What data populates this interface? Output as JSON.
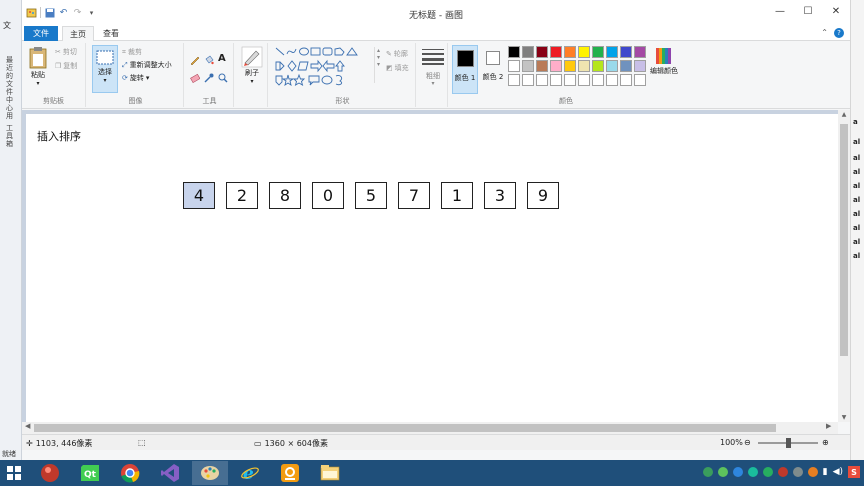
{
  "left_app": {
    "label_top": "文",
    "vertical_text_1": "最近的文件中心用",
    "vertical_text_2": "工具箱",
    "status": "就绪"
  },
  "right_app": {
    "letters": [
      "a",
      "al",
      "al",
      "al",
      "al",
      "al",
      "al",
      "al",
      "al",
      "al",
      "nt"
    ]
  },
  "window": {
    "title": "无标题 - 画图",
    "controls": {
      "minimize": "—",
      "maximize": "☐",
      "close": "✕"
    }
  },
  "tabs": {
    "file": "文件",
    "home": "主页",
    "view": "查看",
    "collapse": "⌃"
  },
  "ribbon": {
    "clipboard": {
      "label": "剪贴板",
      "paste": "粘贴",
      "cut": "剪切",
      "copy": "复制"
    },
    "image": {
      "label": "图像",
      "select": "选择",
      "crop": "裁剪",
      "resize": "重新调整大小",
      "rotate": "旋转"
    },
    "tools": {
      "label": "工具"
    },
    "brushes": {
      "label": "刷子"
    },
    "shapes": {
      "label": "形状",
      "outline": "轮廓",
      "fill": "填充"
    },
    "size": {
      "label": "粗细"
    },
    "colors": {
      "label": "颜色",
      "color1": "颜色 1",
      "color2": "颜色 2",
      "edit": "编辑颜色",
      "color1_value": "#000000",
      "color2_value": "#ffffff",
      "row1": [
        "#000000",
        "#7f7f7f",
        "#880015",
        "#ed1c24",
        "#ff7f27",
        "#fff200",
        "#22b14c",
        "#00a2e8",
        "#3f48cc",
        "#a349a4"
      ],
      "row2": [
        "#ffffff",
        "#c3c3c3",
        "#b97a57",
        "#ffaec9",
        "#ffc90e",
        "#efe4b0",
        "#b5e61d",
        "#99d9ea",
        "#7092be",
        "#c8bfe7"
      ],
      "row3": [
        "#ffffff",
        "#ffffff",
        "#ffffff",
        "#ffffff",
        "#ffffff",
        "#ffffff",
        "#ffffff",
        "#ffffff",
        "#ffffff",
        "#ffffff"
      ]
    }
  },
  "canvas": {
    "heading": "插入排序",
    "numbers": [
      "4",
      "2",
      "8",
      "0",
      "5",
      "7",
      "1",
      "3",
      "9"
    ],
    "highlighted_index": 0
  },
  "statusbar": {
    "cursor": "1103, 446像素",
    "dimensions": "1360 × 604像素",
    "zoom": "100%",
    "zoom_out": "⊖",
    "zoom_in": "⊕"
  },
  "taskbar": {
    "items": [
      "start",
      "record",
      "qt-creator",
      "chrome",
      "visual-studio",
      "paint",
      "ie",
      "foxit",
      "explorer"
    ],
    "tray_time": "S"
  }
}
